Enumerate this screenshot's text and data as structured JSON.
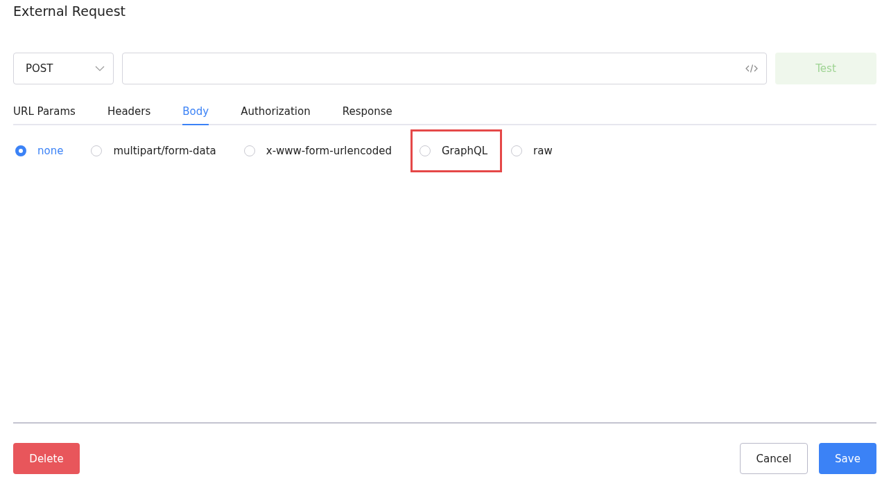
{
  "title": "External Request",
  "request": {
    "method": "POST",
    "test_button": {
      "label": "Test",
      "disabled": true
    }
  },
  "tabs": [
    {
      "label": "URL Params",
      "selected": false
    },
    {
      "label": "Headers",
      "selected": false
    },
    {
      "label": "Body",
      "selected": true
    },
    {
      "label": "Authorization",
      "selected": false
    },
    {
      "label": "Response",
      "selected": false
    }
  ],
  "body_types": [
    {
      "label": "none",
      "selected": true,
      "highlighted": false
    },
    {
      "label": "multipart/form-data",
      "selected": false,
      "highlighted": false
    },
    {
      "label": "x-www-form-urlencoded",
      "selected": false,
      "highlighted": false
    },
    {
      "label": "GraphQL",
      "selected": false,
      "highlighted": true
    },
    {
      "label": "raw",
      "selected": false,
      "highlighted": false
    }
  ],
  "footer": {
    "delete": "Delete",
    "cancel": "Cancel",
    "save": "Save"
  }
}
